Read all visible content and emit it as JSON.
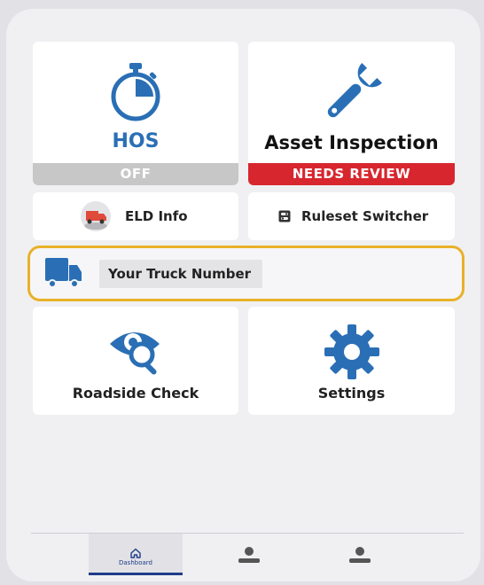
{
  "tiles": {
    "hos": {
      "title": "HOS",
      "status": "OFF",
      "title_color": "#2a6fb5",
      "status_bg": "#c7c7c7"
    },
    "asset": {
      "title": "Asset Inspection",
      "status": "NEEDS REVIEW",
      "title_color": "#111111",
      "status_bg": "#d8262f"
    },
    "roadside": {
      "title": "Roadside Check"
    },
    "settings": {
      "title": "Settings"
    }
  },
  "small_cards": {
    "eld_info": "ELD Info",
    "ruleset": "Ruleset Switcher"
  },
  "truck": {
    "label": "Your Truck Number"
  },
  "nav": {
    "tabs": [
      {
        "label": "Dashboard",
        "icon": "home-icon",
        "active": true
      },
      {
        "label": "",
        "icon": "user-icon",
        "active": false
      },
      {
        "label": "",
        "icon": "user-icon",
        "active": false
      }
    ]
  },
  "colors": {
    "accent_blue": "#2a6fb5",
    "highlight_border": "#e8b128",
    "needs_review_red": "#d8262f"
  }
}
